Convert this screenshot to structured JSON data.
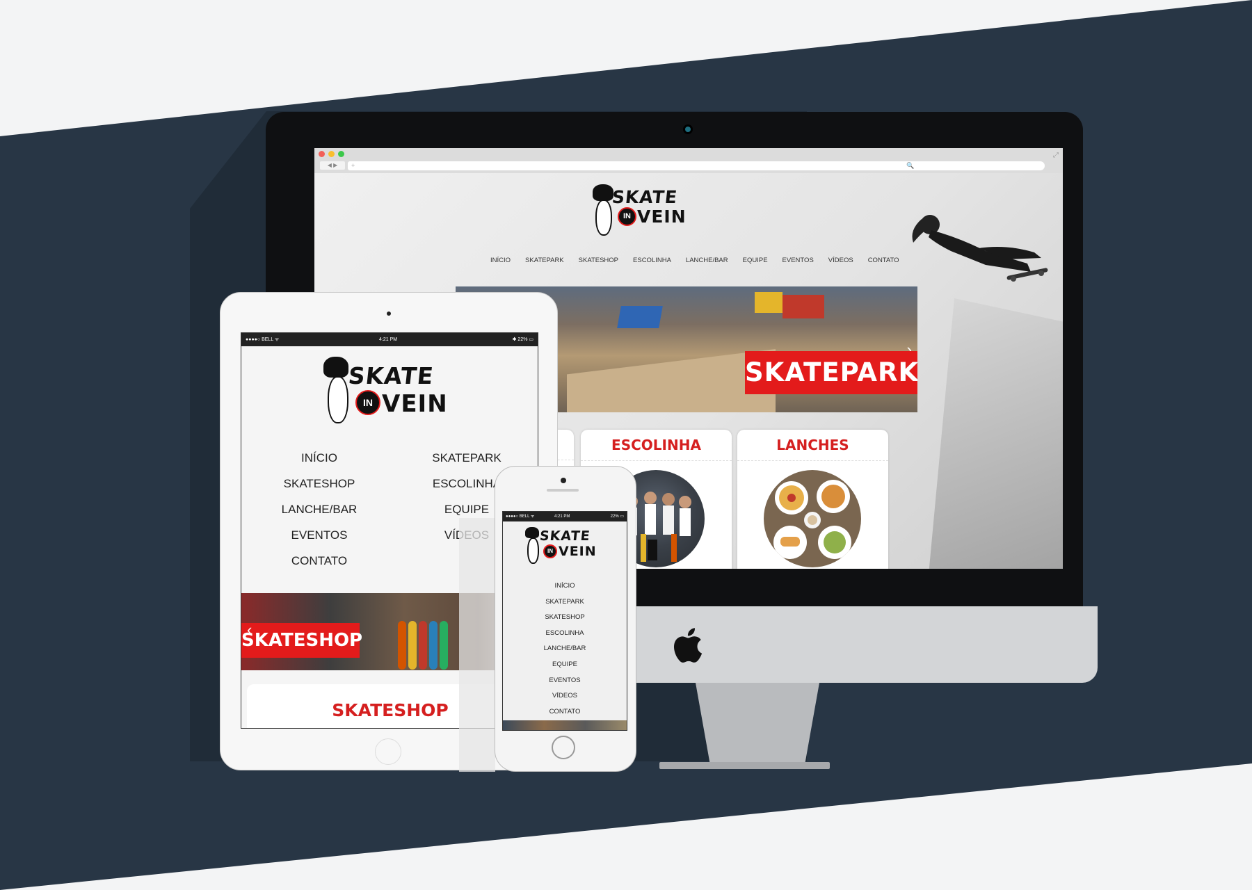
{
  "brand": {
    "logo_top": "SKATE",
    "logo_badge": "IN",
    "logo_bottom": "VEIN"
  },
  "desktop": {
    "browser": {
      "back_forward": "◀ ▶",
      "url_placeholder": "+",
      "search_placeholder": "🔍"
    },
    "nav": [
      "INÍCIO",
      "SKATEPARK",
      "SKATESHOP",
      "ESCOLINHA",
      "LANCHE/BAR",
      "EQUIPE",
      "EVENTOS",
      "VÍDEOS",
      "CONTATO"
    ],
    "hero_label": "SKATEPARK",
    "cards": [
      "OP",
      "ESCOLINHA",
      "LANCHES"
    ]
  },
  "tablet": {
    "status": {
      "carrier": "●●●●○ BELL ᯤ",
      "time": "4:21 PM",
      "battery": "✱ 22% ▭"
    },
    "nav_left": [
      "INÍCIO",
      "SKATESHOP",
      "LANCHE/BAR",
      "EVENTOS",
      "CONTATO"
    ],
    "nav_right": [
      "SKATEPARK",
      "ESCOLINHA",
      "EQUIPE",
      "VÍDEOS"
    ],
    "hero_label": "SKATESHOP",
    "section_title": "SKATESHOP"
  },
  "phone": {
    "status": {
      "carrier": "●●●●○ BELL ᯤ",
      "time": "4:21 PM",
      "battery": "22% ▭"
    },
    "nav": [
      "INÍCIO",
      "SKATEPARK",
      "SKATESHOP",
      "ESCOLINHA",
      "LANCHE/BAR",
      "EQUIPE",
      "EVENTOS",
      "VÍDEOS",
      "CONTATO"
    ]
  },
  "colors": {
    "accent_red": "#e31b1b",
    "background_navy": "#283645"
  }
}
